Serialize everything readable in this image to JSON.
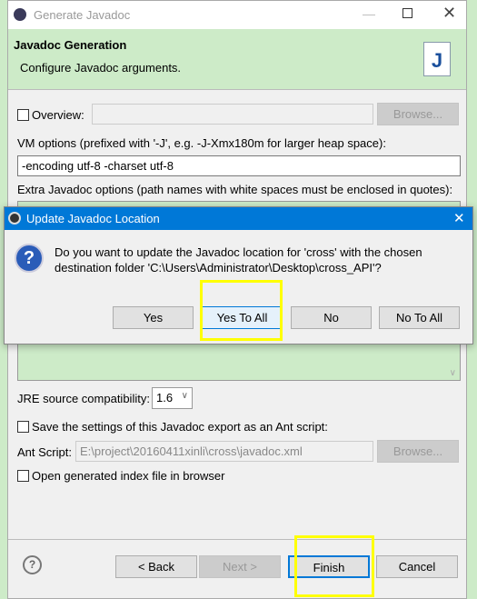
{
  "window": {
    "title": "Generate Javadoc",
    "header_title": "Javadoc Generation",
    "header_subtitle": "Configure Javadoc arguments."
  },
  "form": {
    "overview_label": "Overview:",
    "overview_value": "",
    "browse_label": "Browse...",
    "vm_options_label": "VM options (prefixed with '-J', e.g. -J-Xmx180m for larger heap space):",
    "vm_options_value": "-encoding utf-8 -charset utf-8",
    "extra_options_label": "Extra Javadoc options (path names with white spaces must be enclosed in quotes):",
    "jre_label": "JRE source compatibility:",
    "jre_value": "1.6",
    "save_ant_label": "Save the settings of this Javadoc export as an Ant script:",
    "ant_script_label": "Ant Script:",
    "ant_script_value": "E:\\project\\20160411xinli\\cross\\javadoc.xml",
    "open_index_label": "Open generated index file in browser"
  },
  "footer": {
    "back": "< Back",
    "next": "Next >",
    "finish": "Finish",
    "cancel": "Cancel"
  },
  "dialog": {
    "title": "Update Javadoc Location",
    "message_line1": "Do you want to update the Javadoc location for 'cross' with the chosen",
    "message_line2": "destination folder 'C:\\Users\\Administrator\\Desktop\\cross_API'?",
    "buttons": [
      "Yes",
      "Yes To All",
      "No",
      "No To All"
    ]
  },
  "colors": {
    "accent": "#0078d7",
    "header_bg": "#cdebc8",
    "highlight": "#ffff00"
  }
}
